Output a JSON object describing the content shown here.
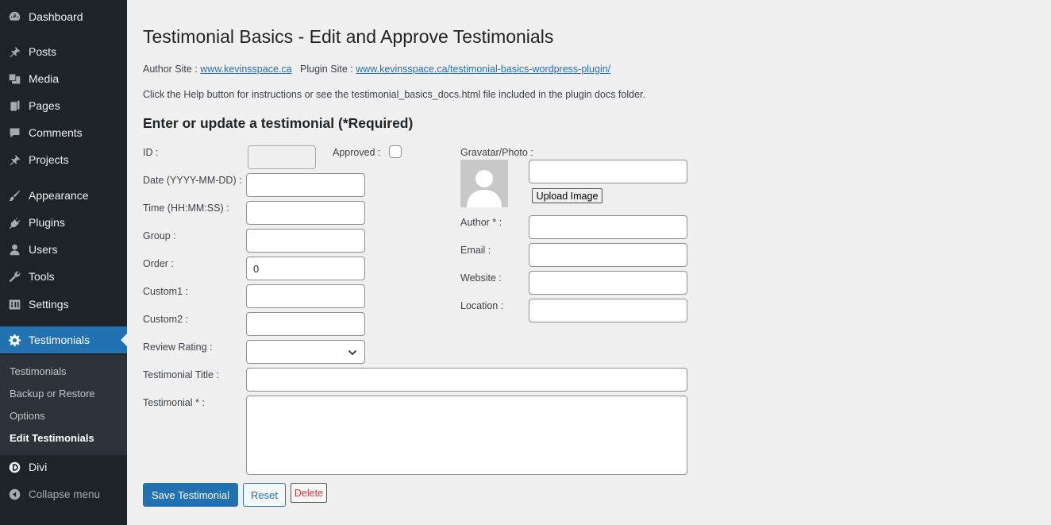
{
  "sidebar": {
    "items": [
      {
        "label": "Dashboard",
        "icon": "dashboard-icon"
      },
      {
        "label": "Posts",
        "icon": "pin-icon"
      },
      {
        "label": "Media",
        "icon": "media-icon"
      },
      {
        "label": "Pages",
        "icon": "pages-icon"
      },
      {
        "label": "Comments",
        "icon": "comment-icon"
      },
      {
        "label": "Projects",
        "icon": "pin-icon"
      },
      {
        "label": "Appearance",
        "icon": "brush-icon"
      },
      {
        "label": "Plugins",
        "icon": "plug-icon"
      },
      {
        "label": "Users",
        "icon": "user-icon"
      },
      {
        "label": "Tools",
        "icon": "wrench-icon"
      },
      {
        "label": "Settings",
        "icon": "settings-icon"
      },
      {
        "label": "Testimonials",
        "icon": "gear-icon"
      }
    ],
    "submenu": [
      "Testimonials",
      "Backup or Restore",
      "Options",
      "Edit Testimonials"
    ],
    "divi": "Divi",
    "collapse": "Collapse menu",
    "colors": {
      "bg": "#1d2327",
      "submenu_bg": "#2c3338",
      "current": "#2271b1"
    }
  },
  "page": {
    "title": "Testimonial Basics - Edit and Approve Testimonials",
    "author_site_label": "Author Site : ",
    "author_site_link": "www.kevinsspace.ca",
    "plugin_site_label": "Plugin Site : ",
    "plugin_site_link": "www.kevinsspace.ca/testimonial-basics-wordpress-plugin/",
    "help_text": "Click the Help button for instructions or see the testimonial_basics_docs.html file included in the plugin docs folder.",
    "section_title": "Enter or update a testimonial (*Required)"
  },
  "form": {
    "id_label": "ID :",
    "approved_label": "Approved :",
    "date_label": "Date (YYYY-MM-DD) :",
    "time_label": "Time (HH:MM:SS) :",
    "group_label": "Group :",
    "order_label": "Order :",
    "order_value": "0",
    "custom1_label": "Custom1 :",
    "custom2_label": "Custom2 :",
    "rating_label": "Review Rating :",
    "title_label": "Testimonial Title :",
    "testimonial_label": "Testimonial * :",
    "gravatar_label": "Gravatar/Photo :",
    "upload_label": "Upload Image",
    "author_label": "Author * :",
    "email_label": "Email :",
    "website_label": "Website :",
    "location_label": "Location :"
  },
  "buttons": {
    "save": "Save Testimonial",
    "reset": "Reset",
    "delete": "Delete"
  }
}
